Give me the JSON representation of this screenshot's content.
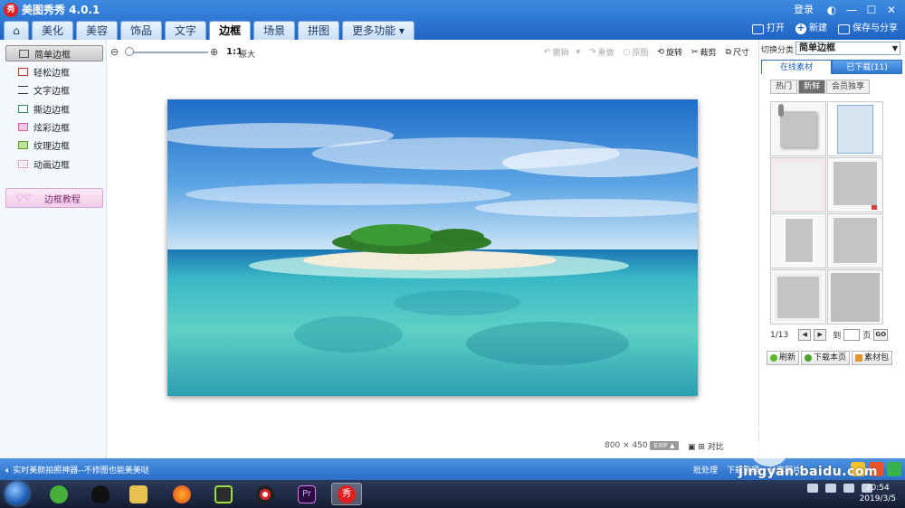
{
  "app": {
    "title": "美图秀秀 4.0.1",
    "logo_char": "秀"
  },
  "window": {
    "login": "登录"
  },
  "tabs": [
    {
      "label": "美化"
    },
    {
      "label": "美容"
    },
    {
      "label": "饰品"
    },
    {
      "label": "文字"
    },
    {
      "label": "边框"
    },
    {
      "label": "场景"
    },
    {
      "label": "拼图"
    },
    {
      "label": "更多功能 ▾"
    }
  ],
  "top_actions": {
    "open": "打开",
    "new": "新建",
    "save_share": "保存与分享"
  },
  "left_panel": {
    "items": [
      {
        "label": "简单边框"
      },
      {
        "label": "轻松边框"
      },
      {
        "label": "文字边框"
      },
      {
        "label": "撕边边框"
      },
      {
        "label": "炫彩边框"
      },
      {
        "label": "纹理边框"
      },
      {
        "label": "动画边框"
      }
    ],
    "tutorial": "边框教程"
  },
  "toolbar": {
    "ratio": "1:1",
    "original": "原大",
    "undo": "撤销",
    "redo": "重做",
    "origin_img": "原图",
    "rotate": "旋转",
    "crop": "裁剪",
    "resize": "尺寸"
  },
  "image_info": {
    "size": "800 × 450",
    "exif": "EXIF ▲",
    "compare": "对比"
  },
  "right_panel": {
    "category_label": "切换分类",
    "category_value": "简单边框",
    "tabs": [
      {
        "label": "在线素材"
      },
      {
        "label": "已下载(11)"
      }
    ],
    "subtabs": [
      {
        "label": "热门"
      },
      {
        "label": "新鲜"
      },
      {
        "label": "会员独享"
      }
    ],
    "pager": {
      "page": "1/13",
      "goto": "到",
      "unit": "页",
      "go": "GO"
    },
    "buttons": {
      "refresh": "刷新",
      "download_page": "下载本页",
      "pack": "素材包"
    }
  },
  "statusbar": {
    "tip": "实时美颜拍照神器--不修图也能美美哒",
    "batch": "批处理",
    "download_mgr": "下载管理",
    "share_img": "分享图片"
  },
  "taskbar": {
    "time": "20:54",
    "date": "2019/3/5"
  },
  "watermark": {
    "text": "jingyan.baidu.com",
    "brand": "经验"
  },
  "colors": {
    "primary": "#2a6ec8",
    "accent": "#e02020"
  }
}
